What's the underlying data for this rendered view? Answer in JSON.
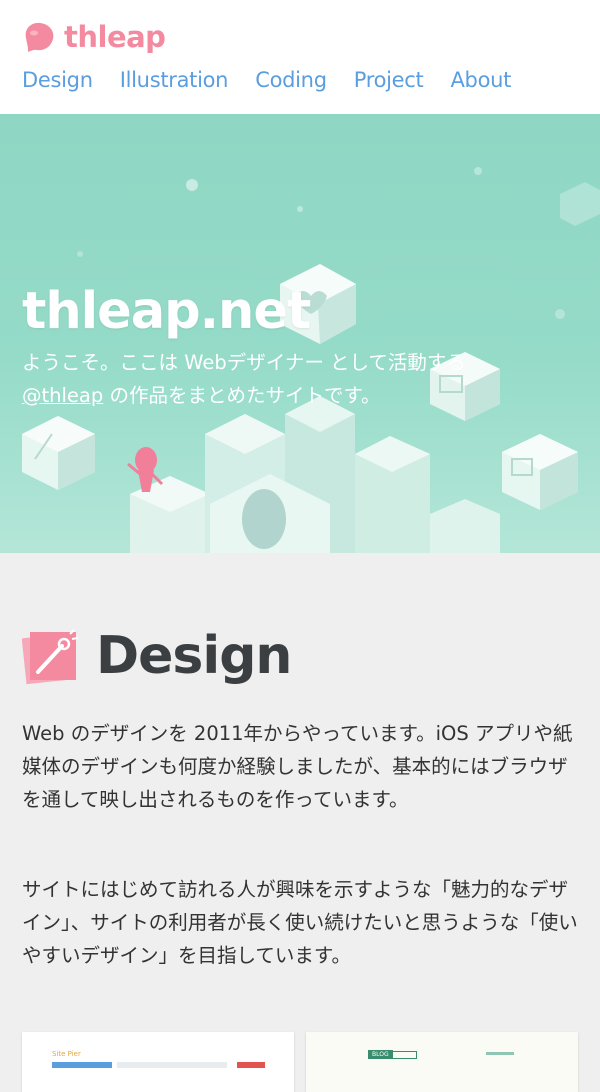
{
  "header": {
    "logo_text": "thleap",
    "nav": [
      "Design",
      "Illustration",
      "Coding",
      "Project",
      "About"
    ]
  },
  "hero": {
    "title": "thleap.net",
    "tagline_line1": "ようこそ。ここは Webデザイナー として活動する",
    "tagline_link": "@thleap",
    "tagline_line2_rest": " の作品をまとめたサイトです。"
  },
  "design": {
    "title": "Design",
    "para1": "Web のデザインを 2011年からやっています。iOS アプリや紙媒体のデザインも何度か経験しましたが、基本的にはブラウザを通して映し出されるものを作っています。",
    "para2": "サイトにはじめて訪れる人が興味を示すような「魅力的なデザイン」、サイトの利用者が長く使い続けたいと思うような「使いやすいデザイン」を目指しています。"
  },
  "thumbs": {
    "left_badge": "Site Pier",
    "right_badge": "BLOG"
  },
  "colors": {
    "brand_pink": "#f48aa0",
    "nav_blue": "#5b9ee0",
    "hero_teal": "#95dbc8",
    "page_bg": "#eeefee"
  }
}
